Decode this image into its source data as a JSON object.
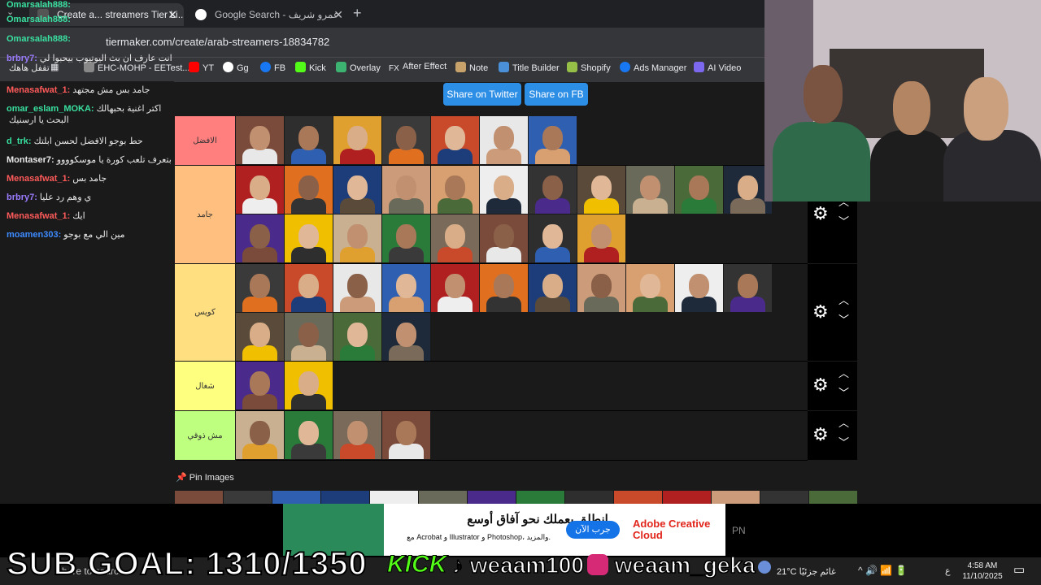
{
  "browser": {
    "tab_active": "Create a... streamers Tier Li...",
    "tab_second": "Google Search - عمرو شريف",
    "url": "tiermaker.com/create/arab-streamers-18834782",
    "bookmarks": [
      "Apps",
      "EHC-MOHP - EETest...",
      "YT",
      "Gg",
      "FB",
      "Kick",
      "Overlay",
      "After Effect",
      "Note",
      "Title Builder",
      "Shopify",
      "Ads Manager",
      "AI Video"
    ]
  },
  "chat": [
    {
      "user": "Omarsalah888:",
      "text": "",
      "color": "#39e0a0"
    },
    {
      "user": "Omarsalah888:",
      "text": "",
      "color": "#39e0a0"
    },
    {
      "user": "Omarsalah888:",
      "text": "",
      "color": "#39e0a0"
    },
    {
      "user": "brbry7:",
      "text": "وهو انت عارف ان بث اليوتيوب بيحبوا لي",
      "color": "#9b7bff"
    },
    {
      "user": "",
      "text": "تقفل هاهك",
      "color": "#e8e8e8"
    },
    {
      "user": "Menasafwat_1:",
      "text": "جامد بس مش مجتهد",
      "color": "#ff5a5a"
    },
    {
      "user": "omar_eslam_MOKA:",
      "text": "اكتر اغنية بحبهالك",
      "color": "#39e0a0"
    },
    {
      "user": "",
      "text": "البحث يا ارسنيك",
      "color": "#e8e8e8"
    },
    {
      "user": "d_trk:",
      "text": "حط بوجو الافضل لحسن ابلتك",
      "color": "#39e0a0"
    },
    {
      "user": "Montaser7:",
      "text": "بتعرف تلعب كورة يا موسكوووو",
      "color": "#e8e8e8"
    },
    {
      "user": "Menasafwat_1:",
      "text": "جامد بس",
      "color": "#ff5a5a"
    },
    {
      "user": "brbry7:",
      "text": "ي وهم رد عليا",
      "color": "#9b7bff"
    },
    {
      "user": "Menasafwat_1:",
      "text": "ايك",
      "color": "#ff5a5a"
    },
    {
      "user": "moamen303:",
      "text": "مين الي مع بوجو",
      "color": "#3d8bff"
    }
  ],
  "share": {
    "twitter": "Share on Twitter",
    "fb": "Share on FB"
  },
  "tiers": [
    {
      "label": "الافضل",
      "color": "#ff7f7f"
    },
    {
      "label": "جامد",
      "color": "#ffbf7f"
    },
    {
      "label": "كويس",
      "color": "#ffdf7f"
    },
    {
      "label": "شغال",
      "color": "#ffff7f"
    },
    {
      "label": "مش ذوقي",
      "color": "#bfff7f"
    }
  ],
  "pin_images": "Pin Images",
  "overlay": {
    "sub_goal": "SUB GOAL: 1310/1350",
    "kick": "KICK",
    "tiktok": "weaam100",
    "instagram": "weaam_geka"
  },
  "ad": {
    "headline": "انطلق بعملك نحو آفاق أوسع.",
    "sub": "مع Acrobat و Illustrator و Photoshop، والمزيد.",
    "button": "جرب الآن",
    "brand": "Adobe Creative Cloud"
  },
  "taskbar": {
    "search": "here to search",
    "weather": "21°C غائم جزئيًا",
    "time": "4:58 AM",
    "date": "11/10/2025",
    "lang": "ع"
  }
}
